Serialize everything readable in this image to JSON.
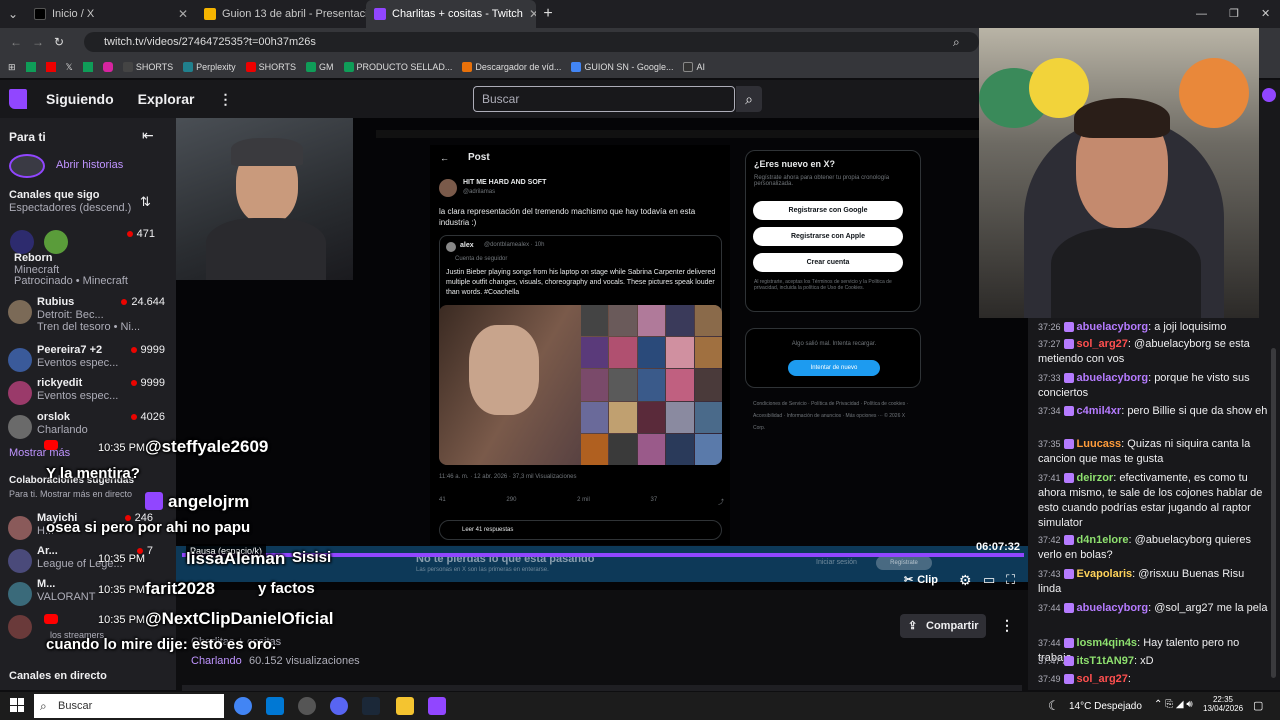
{
  "browser": {
    "tabs": [
      {
        "title": "Inicio / X",
        "color": "#000000",
        "icon": "x-logo-icon"
      },
      {
        "title": "Guion 13 de abril - Presentación",
        "color": "#f4b400",
        "icon": "slides-icon"
      },
      {
        "title": "Charlitas + cositas - Twitch",
        "color": "#9146ff",
        "icon": "twitch-icon"
      }
    ],
    "new_tab": "+",
    "url": "twitch.tv/videos/2746472535?t=00h37m26s",
    "bookmarks": [
      "SHORTS",
      "Perplexity",
      "SHORTS",
      "GM",
      "PRODUCTO SELLAD...",
      "Descargador de víd...",
      "GUION SN - Google...",
      "AI"
    ]
  },
  "twitch": {
    "nav": {
      "following": "Siguiendo",
      "browse": "Explorar",
      "more": "⋮"
    },
    "search_placeholder": "Buscar",
    "sidebar": {
      "for_you": "Para ti",
      "open_stories": "Abrir historias",
      "followed_header": "Canales que sigo",
      "sort": "Espectadores (descend.)",
      "channels": [
        {
          "name": "Reborn",
          "game": "Minecraft",
          "extra": "Patrocinado • Minecraft",
          "viewers": "471"
        },
        {
          "name": "Rubius",
          "game": "Detroit: Bec...",
          "extra": "Tren del tesoro • Ni...",
          "viewers": "24.644"
        },
        {
          "name": "Peereira7 +2",
          "game": "Eventos espec...",
          "viewers": "9999"
        },
        {
          "name": "rickyedit",
          "game": "Eventos espec...",
          "viewers": "9999"
        },
        {
          "name": "orslok",
          "game": "Charlando",
          "viewers": "4026"
        }
      ],
      "show_more": "Mostrar más",
      "suggested_header": "Colaboraciones sugeridas",
      "suggested_sub": "Para ti. Mostrar más en directo",
      "suggested": [
        {
          "name": "Mayichi",
          "game": "H...",
          "viewers": "246"
        },
        {
          "name": "Ar...",
          "game": "League of Lege...",
          "viewers": "7"
        },
        {
          "name": "M...",
          "game": "VALORANT",
          "viewers": ""
        },
        {
          "name": "",
          "game": "",
          "viewers": ""
        }
      ],
      "live_channels": "Canales en directo"
    },
    "player": {
      "time": "06:07:32",
      "clip": "Clip",
      "pause_tooltip": "Pausa (espacio/k)"
    },
    "below": {
      "title": "Charlitas + cositas",
      "category": "Charlando",
      "views": "60.152 visualizaciones",
      "share": "Compartir"
    }
  },
  "x_post": {
    "header": "Post",
    "author": "HIT ME HARD AND SOFT",
    "handle": "@adrilamas",
    "text": "la clara representación del tremendo machismo que hay todavía en esta industria :)",
    "quoted_author": "alex",
    "quoted_handle": "@dontblamealex · 10h",
    "quoted_note": "Cuenta de seguidor",
    "quoted_text": "Justin Bieber playing songs from his laptop on stage while Sabrina Carpenter delivered multiple outfit changes, visuals, choreography and vocals. These pictures speak louder than words. #Coachella",
    "meta": "11:46 a. m. · 12 abr. 2026 · 37,3 mil Visualizaciones",
    "stats": [
      "41",
      "290",
      "2 mil",
      "37"
    ],
    "read_replies": "Leer 41 respuestas",
    "new_to_x": "¿Eres nuevo en X?",
    "signup_sub": "Regístrate ahora para obtener tu propia cronología personalizada.",
    "google": "Registrarse con Google",
    "apple": "Registrarse con Apple",
    "create": "Crear cuenta",
    "terms": "Al registrarte, aceptas los Términos de servicio y la Política de privacidad, incluida la política de Uso de Cookies.",
    "error": "Algo salió mal. Intenta recargar.",
    "retry": "Intentar de nuevo",
    "footer": "Condiciones de Servicio · Política de Privacidad · Política de cookies · Accesibilidad · Información de anuncios · Más opciones ··· © 2026 X Corp.",
    "banner": "No te pierdas lo que está pasando",
    "banner_sub": "Las personas en X son las primeras en enterarse.",
    "login": "Iniciar sesión",
    "register": "Regístrate"
  },
  "overlay": {
    "lines": [
      {
        "handle": "@steffyale2609",
        "time": "10:35 PM",
        "caption": "Y la mentira?"
      },
      {
        "handle": "angelojrm",
        "time": "",
        "caption": "osea si pero por ahi no papu"
      },
      {
        "handle": "lissaAleman",
        "time": "10:35 PM",
        "caption": "Sisisi"
      },
      {
        "handle": "farit2028",
        "time": "10:35 PM",
        "caption": "y factos"
      },
      {
        "handle": "@NextClipDanielOficial",
        "time": "10:35 PM",
        "caption": "cuando lo mire dije: esto es oro."
      }
    ],
    "faint": "los streamers"
  },
  "chat": [
    {
      "time": "37:26",
      "user": "abuelacyborg",
      "color": "#b57bff",
      "text": "a joji loquisimo"
    },
    {
      "time": "37:27",
      "user": "sol_arg27",
      "color": "#ff4f4f",
      "text": "@abuelacyborg se esta metiendo con vos"
    },
    {
      "time": "37:33",
      "user": "abuelacyborg",
      "color": "#b57bff",
      "text": "porque he visto sus conciertos"
    },
    {
      "time": "37:34",
      "user": "c4mil4xr",
      "color": "#b57bff",
      "text": "pero Billie si que da show eh"
    },
    {
      "time": "37:35",
      "user": "Luucass",
      "color": "#ff9c3b",
      "text": "Quizas ni siquira canta la cancion que mas te gusta"
    },
    {
      "time": "37:41",
      "user": "deirzor",
      "color": "#8ee06f",
      "text": "efectivamente, es como tu ahora mismo, te sale de los cojones hablar de esto cuando podrías estar jugando al raptor simulator"
    },
    {
      "time": "37:42",
      "user": "d4n1elore",
      "color": "#8ee06f",
      "text": "@abuelacyborg quieres verlo en bolas?"
    },
    {
      "time": "37:43",
      "user": "Evapolaris",
      "color": "#ffd35a",
      "text": "@risxuu Buenas Risu linda"
    },
    {
      "time": "37:44",
      "user": "abuelacyborg",
      "color": "#b57bff",
      "text": "@sol_arg27 me la pela"
    },
    {
      "time": "37:44",
      "user": "losm4qin4s",
      "color": "#8ee06f",
      "text": "Hay talento pero no trabajo"
    },
    {
      "time": "37:47",
      "user": "itsT1tAN97",
      "color": "#8ee06f",
      "text": "xD"
    },
    {
      "time": "37:49",
      "user": "sol_arg27",
      "color": "#ff4f4f",
      "text": ""
    }
  ],
  "taskbar": {
    "search": "Buscar",
    "weather": "14°C  Despejado",
    "time": "22:35",
    "date": "13/04/2026"
  },
  "colors": {
    "twitch_purple": "#9146ff",
    "live_red": "#eb0400",
    "x_blue": "#1d9bf0"
  }
}
